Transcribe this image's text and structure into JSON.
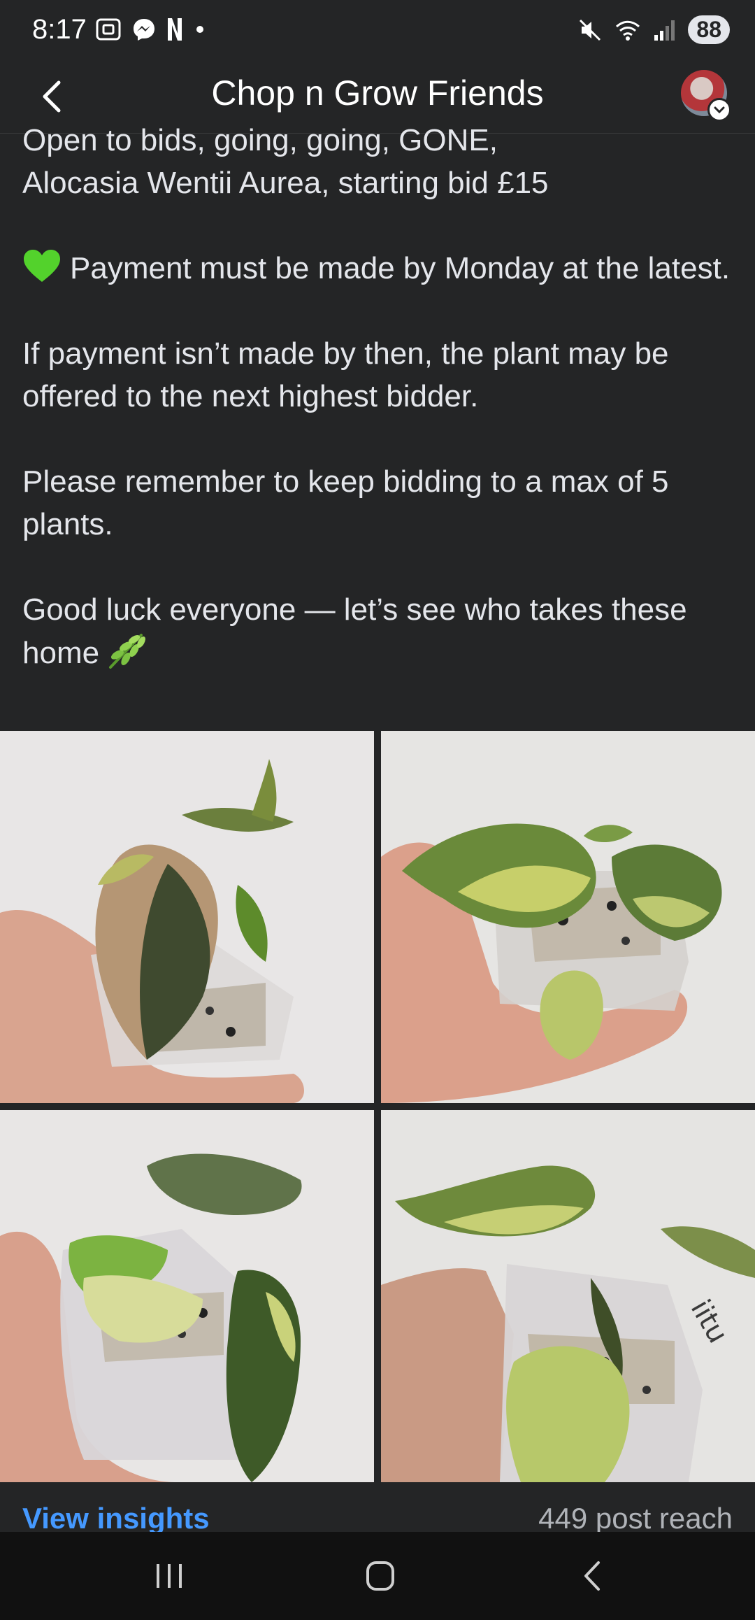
{
  "status_bar": {
    "time": "8:17",
    "battery": "88",
    "icons": [
      "screenshot-icon",
      "messenger-icon",
      "netflix-icon",
      "dot-icon",
      "mute-icon",
      "wifi-icon",
      "signal-icon"
    ]
  },
  "header": {
    "title": "Chop n Grow Friends",
    "back_icon": "chevron-left-icon"
  },
  "post": {
    "line1": "Open to bids, going, going, GONE,",
    "line2": "Alocasia Wentii Aurea, starting bid £15",
    "payment": "Payment must be made by Monday at the latest.",
    "nonpayment": "If payment isn’t made by then, the plant may be offered to the next highest bidder.",
    "reminder": "Please remember to keep bidding to a max of 5 plants.",
    "good_luck": "Good luck everyone — let’s see who takes these home"
  },
  "photos": [
    "plant-photo-1",
    "plant-photo-2",
    "plant-photo-3",
    "plant-photo-4"
  ],
  "footer": {
    "view_insights": "View insights",
    "post_reach": "449 post reach"
  },
  "colors": {
    "background": "#242526",
    "link": "#4599ff",
    "text": "#e4e6eb"
  }
}
